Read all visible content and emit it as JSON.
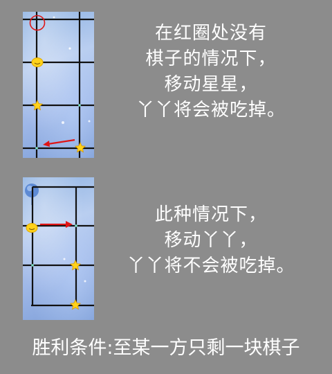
{
  "tutorial": {
    "step1": {
      "lines": [
        "在红圈处没有",
        "棋子的情况下，",
        "移动星星，",
        "丫丫将会被吃掉。"
      ],
      "board": {
        "pieces": [
          "yaya",
          "star",
          "star"
        ],
        "markers": [
          "red-circle",
          "red-arrow"
        ]
      }
    },
    "step2": {
      "lines": [
        "此种情况下，",
        "移动丫丫，",
        "丫丫将不会被吃掉。"
      ],
      "board": {
        "pieces": [
          "yaya",
          "star",
          "star"
        ],
        "markers": [
          "red-arrow"
        ]
      }
    },
    "win_condition": "胜利条件:至某一方只剩一块棋子"
  },
  "colors": {
    "background": "#8c8c8c",
    "board_blue": "#9fb8e8",
    "grid_line": "#111111",
    "marker_red": "#e01515",
    "star_yellow": "#ffd21a",
    "text": "#ffffff"
  }
}
